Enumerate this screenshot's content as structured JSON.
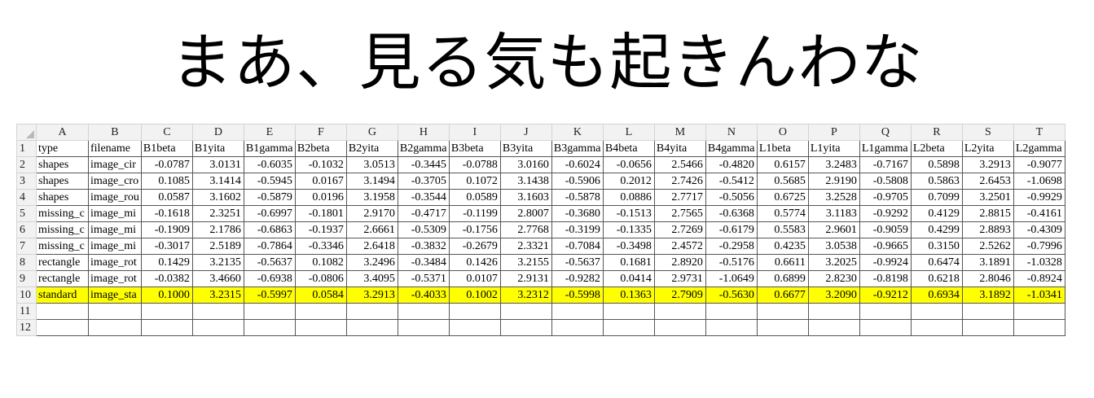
{
  "title": "まあ、見る気も起きんわな",
  "columns": [
    "A",
    "B",
    "C",
    "D",
    "E",
    "F",
    "G",
    "H",
    "I",
    "J",
    "K",
    "L",
    "M",
    "N",
    "O",
    "P",
    "Q",
    "R",
    "S",
    "T"
  ],
  "rows": [
    {
      "n": "1",
      "cells": [
        "type",
        "filename",
        "B1beta",
        "B1yita",
        "B1gamma",
        "B2beta",
        "B2yita",
        "B2gamma",
        "B3beta",
        "B3yita",
        "B3gamma",
        "B4beta",
        "B4yita",
        "B4gamma",
        "L1beta",
        "L1yita",
        "L1gamma",
        "L2beta",
        "L2yita",
        "L2gamma"
      ]
    },
    {
      "n": "2",
      "cells": [
        "shapes",
        "image_cir",
        "-0.0787",
        "3.0131",
        "-0.6035",
        "-0.1032",
        "3.0513",
        "-0.3445",
        "-0.0788",
        "3.0160",
        "-0.6024",
        "-0.0656",
        "2.5466",
        "-0.4820",
        "0.6157",
        "3.2483",
        "-0.7167",
        "0.5898",
        "3.2913",
        "-0.9077"
      ]
    },
    {
      "n": "3",
      "cells": [
        "shapes",
        "image_cro",
        "0.1085",
        "3.1414",
        "-0.5945",
        "0.0167",
        "3.1494",
        "-0.3705",
        "0.1072",
        "3.1438",
        "-0.5906",
        "0.2012",
        "2.7426",
        "-0.5412",
        "0.5685",
        "2.9190",
        "-0.5808",
        "0.5863",
        "2.6453",
        "-1.0698"
      ]
    },
    {
      "n": "4",
      "cells": [
        "shapes",
        "image_rou",
        "0.0587",
        "3.1602",
        "-0.5879",
        "0.0196",
        "3.1958",
        "-0.3544",
        "0.0589",
        "3.1603",
        "-0.5878",
        "0.0886",
        "2.7717",
        "-0.5056",
        "0.6725",
        "3.2528",
        "-0.9705",
        "0.7099",
        "3.2501",
        "-0.9929"
      ]
    },
    {
      "n": "5",
      "cells": [
        "missing_c",
        "image_mi",
        "-0.1618",
        "2.3251",
        "-0.6997",
        "-0.1801",
        "2.9170",
        "-0.4717",
        "-0.1199",
        "2.8007",
        "-0.3680",
        "-0.1513",
        "2.7565",
        "-0.6368",
        "0.5774",
        "3.1183",
        "-0.9292",
        "0.4129",
        "2.8815",
        "-0.4161"
      ]
    },
    {
      "n": "6",
      "cells": [
        "missing_c",
        "image_mi",
        "-0.1909",
        "2.1786",
        "-0.6863",
        "-0.1937",
        "2.6661",
        "-0.5309",
        "-0.1756",
        "2.7768",
        "-0.3199",
        "-0.1335",
        "2.7269",
        "-0.6179",
        "0.5583",
        "2.9601",
        "-0.9059",
        "0.4299",
        "2.8893",
        "-0.4309"
      ]
    },
    {
      "n": "7",
      "cells": [
        "missing_c",
        "image_mi",
        "-0.3017",
        "2.5189",
        "-0.7864",
        "-0.3346",
        "2.6418",
        "-0.3832",
        "-0.2679",
        "2.3321",
        "-0.7084",
        "-0.3498",
        "2.4572",
        "-0.2958",
        "0.4235",
        "3.0538",
        "-0.9665",
        "0.3150",
        "2.5262",
        "-0.7996"
      ]
    },
    {
      "n": "8",
      "cells": [
        "rectangle",
        "image_rot",
        "0.1429",
        "3.2135",
        "-0.5637",
        "0.1082",
        "3.2496",
        "-0.3484",
        "0.1426",
        "3.2155",
        "-0.5637",
        "0.1681",
        "2.8920",
        "-0.5176",
        "0.6611",
        "3.2025",
        "-0.9924",
        "0.6474",
        "3.1891",
        "-1.0328"
      ]
    },
    {
      "n": "9",
      "cells": [
        "rectangle",
        "image_rot",
        "-0.0382",
        "3.4660",
        "-0.6938",
        "-0.0806",
        "3.4095",
        "-0.5371",
        "0.0107",
        "2.9131",
        "-0.9282",
        "0.0414",
        "2.9731",
        "-1.0649",
        "0.6899",
        "2.8230",
        "-0.8198",
        "0.6218",
        "2.8046",
        "-0.8924"
      ]
    },
    {
      "n": "10",
      "cells": [
        "standard",
        "image_sta",
        "0.1000",
        "3.2315",
        "-0.5997",
        "0.0584",
        "3.2913",
        "-0.4033",
        "0.1002",
        "3.2312",
        "-0.5998",
        "0.1363",
        "2.7909",
        "-0.5630",
        "0.6677",
        "3.2090",
        "-0.9212",
        "0.6934",
        "3.1892",
        "-1.0341"
      ],
      "highlight": true
    },
    {
      "n": "11",
      "cells": [
        "",
        "",
        "",
        "",
        "",
        "",
        "",
        "",
        "",
        "",
        "",
        "",
        "",
        "",
        "",
        "",
        "",
        "",
        "",
        ""
      ]
    },
    {
      "n": "12",
      "cells": [
        "",
        "",
        "",
        "",
        "",
        "",
        "",
        "",
        "",
        "",
        "",
        "",
        "",
        "",
        "",
        "",
        "",
        "",
        "",
        ""
      ]
    }
  ],
  "colors": {
    "highlight": "#ffff00",
    "header_bg": "#f2f2f2"
  }
}
